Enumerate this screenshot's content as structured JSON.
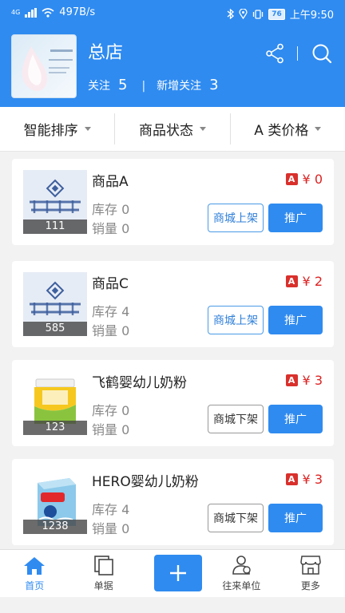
{
  "status_bar": {
    "network_type": "4G",
    "speed": "497B/s",
    "battery": "76",
    "time": "上午9:50"
  },
  "store": {
    "name": "总店",
    "follow_label": "关注",
    "follow_count": "5",
    "new_follow_label": "新增关注",
    "new_follow_count": "3"
  },
  "filters": [
    {
      "label": "智能排序"
    },
    {
      "label": "商品状态"
    },
    {
      "label": "A 类价格"
    }
  ],
  "products": [
    {
      "name": "商品A",
      "stock": "库存 0",
      "sales": "销量 0",
      "price_tag": "A",
      "price": "¥ 0",
      "image_count": "111",
      "shelf_label": "商城上架",
      "promote_label": "推广"
    },
    {
      "name": "商品C",
      "stock": "库存 4",
      "sales": "销量 0",
      "price_tag": "A",
      "price": "¥ 2",
      "image_count": "585",
      "shelf_label": "商城上架",
      "promote_label": "推广"
    },
    {
      "name": "飞鹤婴幼儿奶粉",
      "stock": "库存 0",
      "sales": "销量 0",
      "price_tag": "A",
      "price": "¥ 3",
      "image_count": "123",
      "shelf_label": "商城下架",
      "promote_label": "推广"
    },
    {
      "name": "HERO婴幼儿奶粉",
      "stock": "库存 4",
      "sales": "销量 0",
      "price_tag": "A",
      "price": "¥ 3",
      "image_count": "1238",
      "shelf_label": "商城下架",
      "promote_label": "推广"
    }
  ],
  "nav": {
    "home": "首页",
    "orders": "单据",
    "partners": "往来单位",
    "more": "更多"
  },
  "colors": {
    "primary": "#2f8bf0",
    "price": "#dd2222",
    "tag": "#d9302c"
  }
}
